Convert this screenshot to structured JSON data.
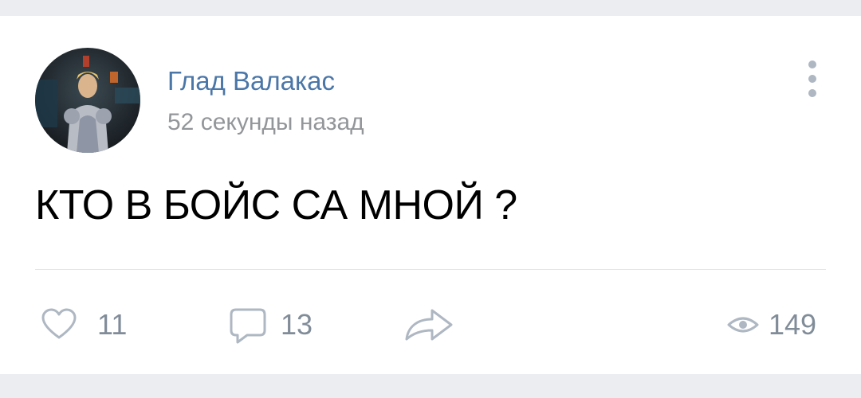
{
  "post": {
    "author": {
      "name": "Глад Валакас",
      "avatar_icon": "avatar-image"
    },
    "time": "52 секунды назад",
    "text": "КТО В БОЙС СА МНОЙ ?",
    "more_icon": "more-vertical-icon"
  },
  "footer": {
    "likes": {
      "icon": "heart-icon",
      "count": "11"
    },
    "comments": {
      "icon": "comment-icon",
      "count": "13"
    },
    "share": {
      "icon": "share-icon"
    },
    "views": {
      "icon": "eye-icon",
      "count": "149"
    }
  },
  "colors": {
    "link": "#4a76a8",
    "secondary": "#939699",
    "icon": "#aeb7c2",
    "background": "#ebedf0"
  }
}
